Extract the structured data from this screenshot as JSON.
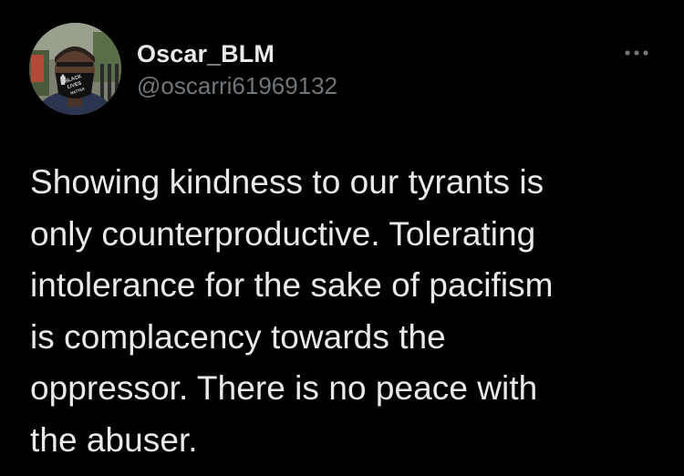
{
  "tweet": {
    "author": {
      "display_name": "Oscar_BLM",
      "handle": "@oscarri61969132",
      "avatar_icon": "profile-photo-icon",
      "mask_text": "BLACK LIVES MATTER"
    },
    "more_icon": "more-dots-icon",
    "text": "Showing kindness to our tyrants is\nonly counterproductive. Tolerating\nintolerance for the sake of pacifism\nis complacency towards the\noppressor. There is no peace with\nthe abuser."
  },
  "colors": {
    "background": "#000000",
    "primary_text": "#e7e9ea",
    "secondary_text": "#71767b"
  }
}
